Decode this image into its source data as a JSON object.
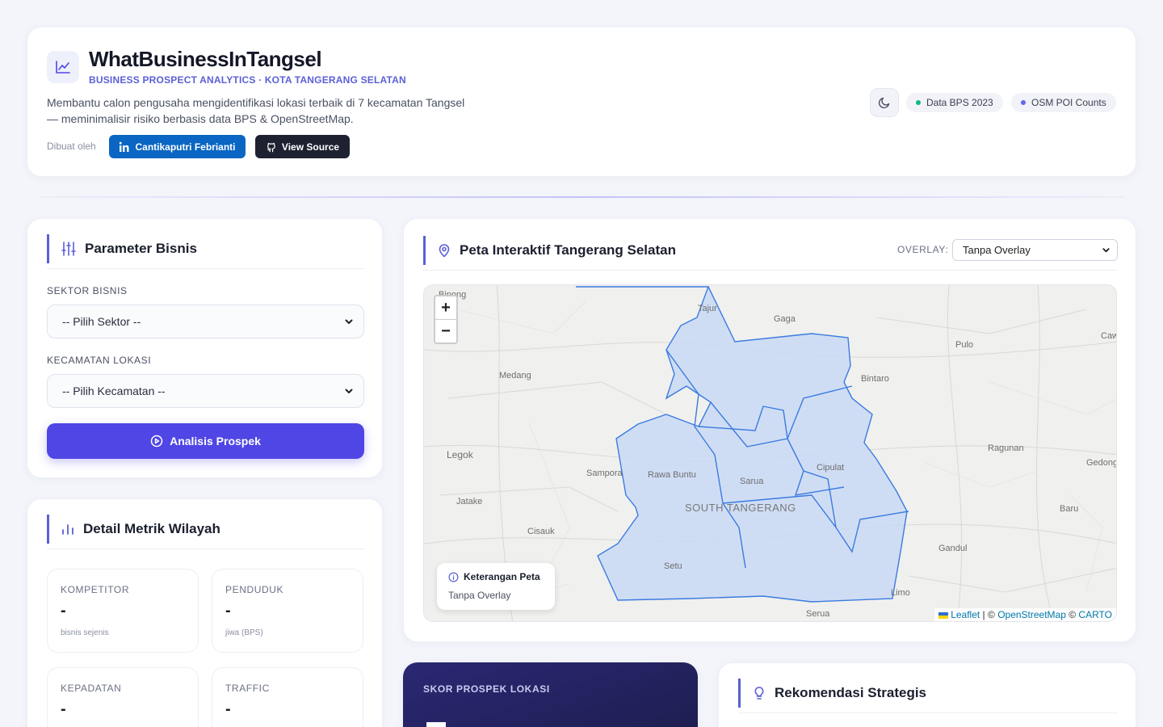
{
  "header": {
    "title": "WhatBusinessInTangsel",
    "subtitle": "BUSINESS PROSPECT ANALYTICS · KOTA TANGERANG SELATAN",
    "description": "Membantu calon pengusaha mengidentifikasi lokasi terbaik di 7 kecamatan Tangsel — meminimalisir risiko berbasis data BPS & OpenStreetMap.",
    "made_by": "Dibuat oleh",
    "author_button": "Cantikaputri Febrianti",
    "source_button": "View Source",
    "pills": [
      {
        "label": "Data BPS 2023",
        "color": "#10b981"
      },
      {
        "label": "OSM POI Counts",
        "color": "#6366f1"
      }
    ]
  },
  "params": {
    "title": "Parameter Bisnis",
    "sector_label": "SEKTOR BISNIS",
    "sector_value": "-- Pilih Sektor --",
    "district_label": "KECAMATAN LOKASI",
    "district_value": "-- Pilih Kecamatan --",
    "analyze_button": "Analisis Prospek"
  },
  "metrics": {
    "title": "Detail Metrik Wilayah",
    "items": [
      {
        "label": "KOMPETITOR",
        "value": "-",
        "sub": "bisnis sejenis"
      },
      {
        "label": "PENDUDUK",
        "value": "-",
        "sub": "jiwa (BPS)"
      },
      {
        "label": "KEPADATAN",
        "value": "-",
        "sub": ""
      },
      {
        "label": "TRAFFIC",
        "value": "-",
        "sub": ""
      }
    ]
  },
  "map": {
    "title": "Peta Interaktif Tangerang Selatan",
    "overlay_label": "OVERLAY:",
    "overlay_value": "Tanpa Overlay",
    "zoom_in": "+",
    "zoom_out": "−",
    "legend_title": "Keterangan Peta",
    "legend_value": "Tanpa Overlay",
    "attribution": {
      "leaflet": "Leaflet",
      "sep1": " | © ",
      "osm": "OpenStreetMap",
      "sep2": " © ",
      "carto": "CARTO"
    },
    "places": [
      {
        "name": "Binong"
      },
      {
        "name": "Tajur"
      },
      {
        "name": "Gaga"
      },
      {
        "name": "Caw"
      },
      {
        "name": "Pulo"
      },
      {
        "name": "Medang"
      },
      {
        "name": "Bintaro"
      },
      {
        "name": "Legok"
      },
      {
        "name": "Ragunan"
      },
      {
        "name": "Sampora"
      },
      {
        "name": "Rawa Buntu"
      },
      {
        "name": "Sarua"
      },
      {
        "name": "Cipulat"
      },
      {
        "name": "Gedong"
      },
      {
        "name": "Jatake"
      },
      {
        "name": "SOUTH TANGERANG"
      },
      {
        "name": "Baru"
      },
      {
        "name": "Cisauk"
      },
      {
        "name": "Gandul"
      },
      {
        "name": "Setu"
      },
      {
        "name": "Limo"
      },
      {
        "name": "Serua"
      }
    ]
  },
  "score": {
    "title": "SKOR PROSPEK LOKASI"
  },
  "rekom": {
    "title": "Rekomendasi Strategis"
  },
  "colors": {
    "accent": "#4f46e5",
    "linkedin": "#0a66c2",
    "region_fill": "#c9d9f5",
    "region_stroke": "#3b7be0"
  }
}
